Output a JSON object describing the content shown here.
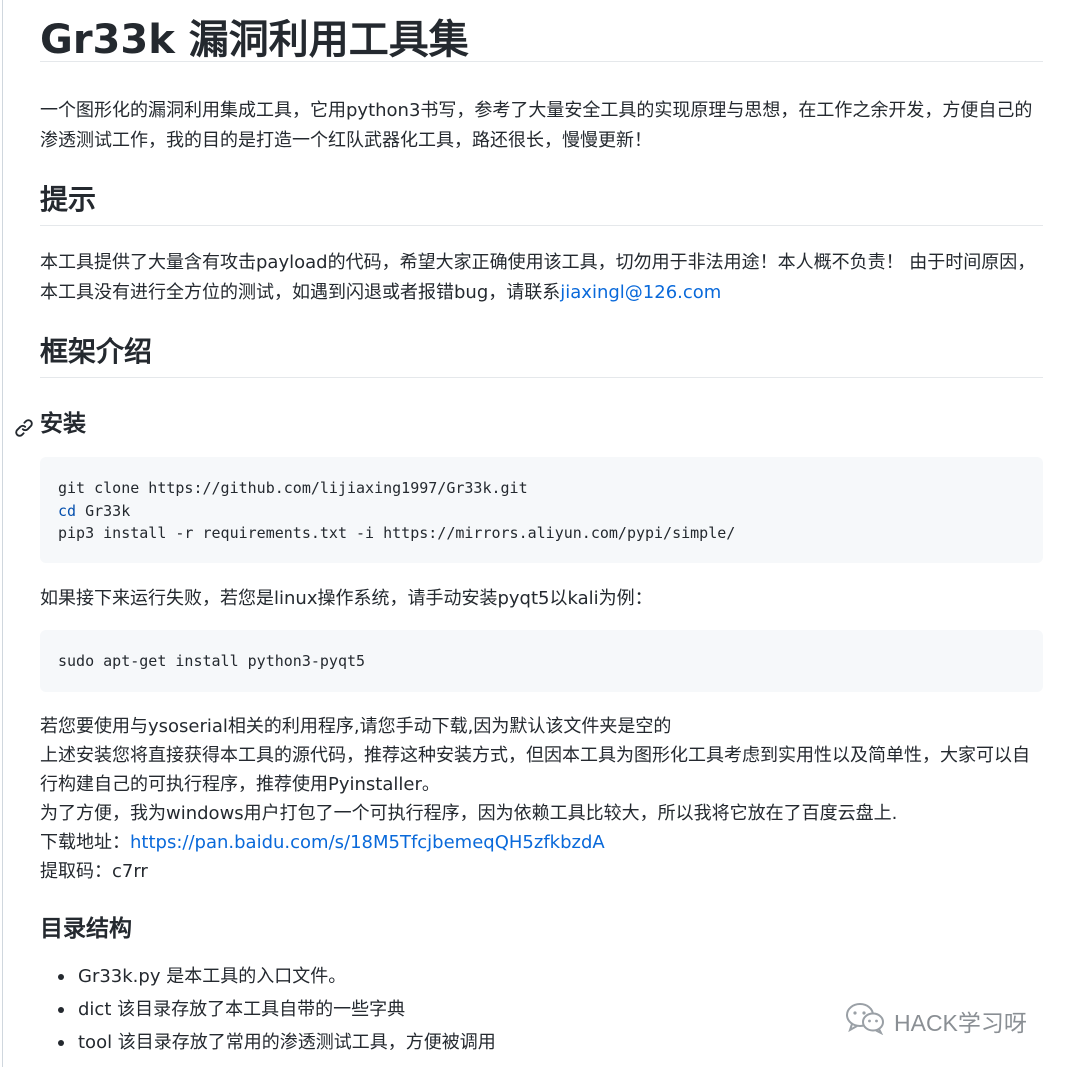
{
  "title": "Gr33k 漏洞利用工具集",
  "intro": "一个图形化的漏洞利用集成工具，它用python3书写，参考了大量安全工具的实现原理与思想，在工作之余开发，方便自己的渗透测试工作，我的目的是打造一个红队武器化工具，路还很长，慢慢更新！",
  "tips": {
    "heading": "提示",
    "text": "本工具提供了大量含有攻击payload的代码，希望大家正确使用该工具，切勿用于非法用途！本人概不负责！ 由于时间原因，本工具没有进行全方位的测试，如遇到闪退或者报错bug，请联系",
    "email": "jiaxingl@126.com"
  },
  "framework": {
    "heading": "框架介绍"
  },
  "install": {
    "heading": "安装",
    "code1": {
      "line1": "git clone https://github.com/lijiaxing1997/Gr33k.git",
      "line2_kw": "cd",
      "line2_rest": " Gr33k",
      "line3": "pip3 install -r requirements.txt -i https://mirrors.aliyun.com/pypi/simple/"
    },
    "fail_text": "如果接下来运行失败，若您是linux操作系统，请手动安装pyqt5以kali为例：",
    "code2": "sudo apt-get install python3-pyqt5",
    "notes": {
      "line1": "若您要使用与ysoserial相关的利用程序,请您手动下载,因为默认该文件夹是空的",
      "line2": "上述安装您将直接获得本工具的源代码，推荐这种安装方式，但因本工具为图形化工具考虑到实用性以及简单性，大家可以自行构建自己的可执行程序，推荐使用Pyinstaller。",
      "line3": "为了方便，我为windows用户打包了一个可执行程序，因为依赖工具比较大，所以我将它放在了百度云盘上.",
      "download_label": "下载地址：",
      "download_url": "https://pan.baidu.com/s/18M5TfcjbemeqQH5zfkbzdA",
      "code_label": "提取码：c7rr"
    }
  },
  "directory": {
    "heading": "目录结构",
    "items": [
      "Gr33k.py 是本工具的入口文件。",
      "dict 该目录存放了本工具自带的一些字典",
      "tool 该目录存放了常用的渗透测试工具，方便被调用"
    ]
  },
  "watermark": "HACK学习呀"
}
